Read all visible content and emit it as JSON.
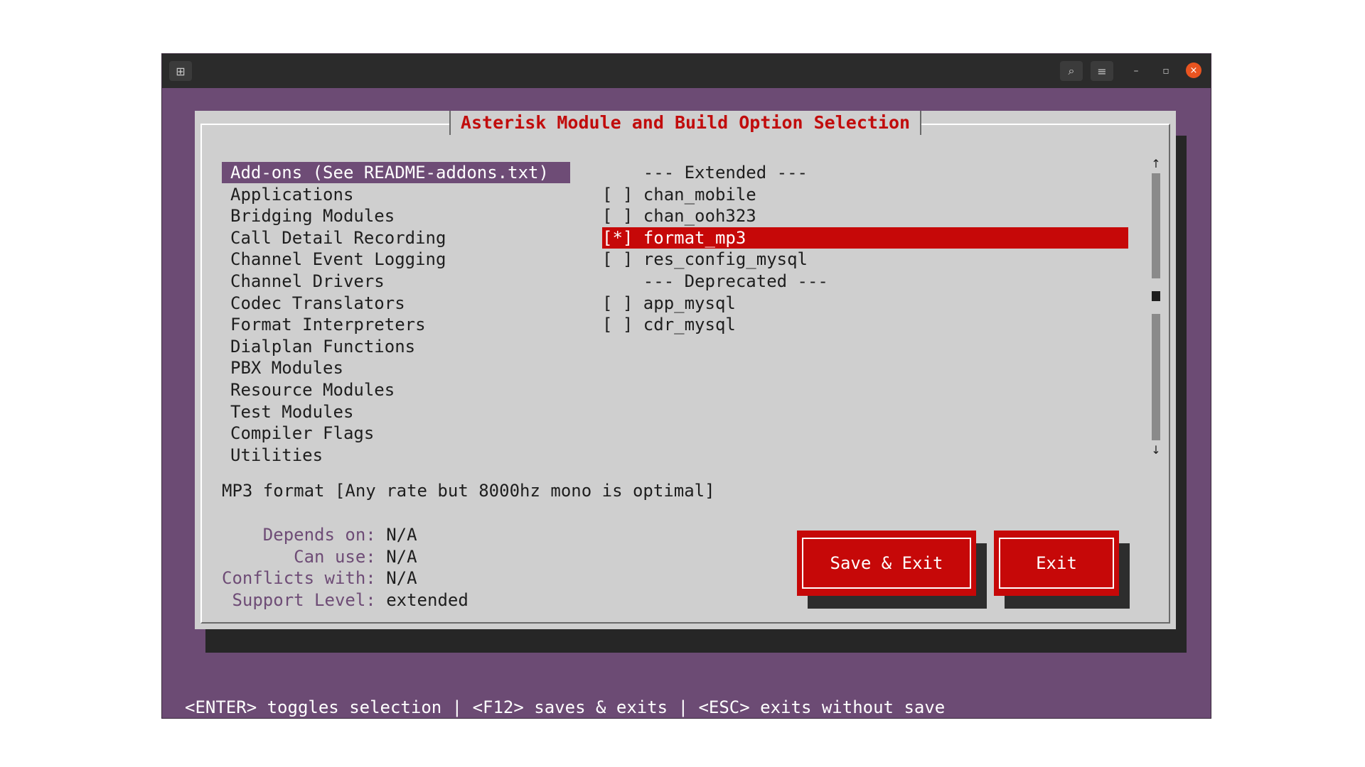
{
  "window": {
    "title": "",
    "controls": {
      "search_glyph": "⌕",
      "menu_glyph": "≡",
      "minimize_glyph": "–",
      "maximize_glyph": "▫",
      "close_glyph": "×"
    }
  },
  "dialog": {
    "title": "Asterisk Module and Build Option Selection",
    "categories": [
      "Add-ons (See README-addons.txt)",
      "Applications",
      "Bridging Modules",
      "Call Detail Recording",
      "Channel Event Logging",
      "Channel Drivers",
      "Codec Translators",
      "Format Interpreters",
      "Dialplan Functions",
      "PBX Modules",
      "Resource Modules",
      "Test Modules",
      "Compiler Flags",
      "Utilities"
    ],
    "selected_category": 0,
    "options": [
      {
        "text": "    --- Extended ---"
      },
      {
        "text": "[ ] chan_mobile"
      },
      {
        "text": "[ ] chan_ooh323"
      },
      {
        "text": "[*] format_mp3",
        "selected": true
      },
      {
        "text": "[ ] res_config_mysql"
      },
      {
        "text": "    --- Deprecated ---"
      },
      {
        "text": "[ ] app_mysql"
      },
      {
        "text": "[ ] cdr_mysql"
      }
    ],
    "scrollbar": {
      "up_glyph": "↑",
      "down_glyph": "↓"
    },
    "description": "MP3 format [Any rate but 8000hz mono is optimal]",
    "info": [
      {
        "label": "    Depends on:",
        "value": " N/A"
      },
      {
        "label": "       Can use:",
        "value": " N/A"
      },
      {
        "label": "Conflicts with:",
        "value": " N/A"
      },
      {
        "label": " Support Level:",
        "value": " extended"
      }
    ],
    "buttons": {
      "save_exit": "Save & Exit",
      "exit": "Exit"
    }
  },
  "hint_bar": "<ENTER> toggles selection | <F12> saves & exits | <ESC> exits without save",
  "colors": {
    "accent_red": "#c60808",
    "accent_purple": "#6e4c76",
    "dialog_bg": "#cfcfcf",
    "terminal_bg": "#6c4b74"
  }
}
